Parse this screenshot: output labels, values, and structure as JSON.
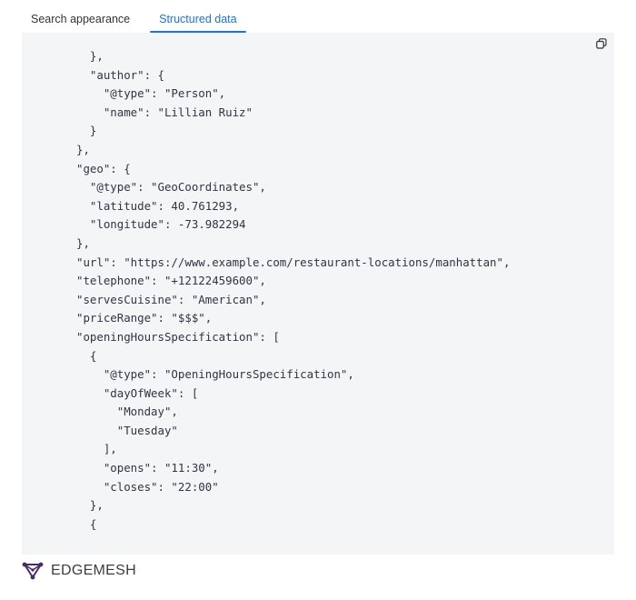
{
  "tabs": [
    {
      "label": "Search appearance",
      "active": false
    },
    {
      "label": "Structured data",
      "active": true
    }
  ],
  "code_panel": {
    "copy_icon": "copy-icon",
    "lines": [
      "  },",
      "  \"author\": {",
      "    \"@type\": \"Person\",",
      "    \"name\": \"Lillian Ruiz\"",
      "  }",
      "},",
      "\"geo\": {",
      "  \"@type\": \"GeoCoordinates\",",
      "  \"latitude\": 40.761293,",
      "  \"longitude\": -73.982294",
      "},",
      "\"url\": \"https://www.example.com/restaurant-locations/manhattan\",",
      "\"telephone\": \"+12122459600\",",
      "\"servesCuisine\": \"American\",",
      "\"priceRange\": \"$$$\",",
      "\"openingHoursSpecification\": [",
      "  {",
      "    \"@type\": \"OpeningHoursSpecification\",",
      "    \"dayOfWeek\": [",
      "      \"Monday\",",
      "      \"Tuesday\"",
      "    ],",
      "    \"opens\": \"11:30\",",
      "    \"closes\": \"22:00\"",
      "  },",
      "  {"
    ]
  },
  "brand": {
    "name": "EDGEMESH",
    "logo_icon": "edgemesh-logo-icon",
    "accent": "#4a2a6e"
  },
  "colors": {
    "tab_active": "#1a73e8",
    "panel_bg": "#f4f5f7"
  }
}
